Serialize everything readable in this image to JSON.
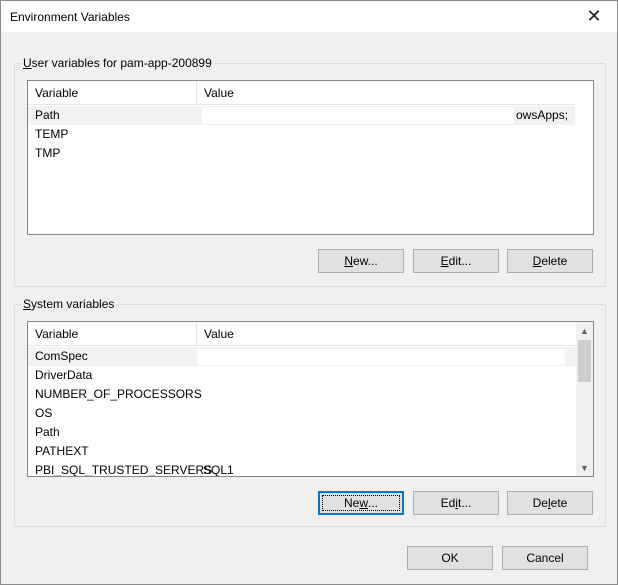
{
  "window": {
    "title": "Environment Variables",
    "close_glyph": "✕"
  },
  "user_group": {
    "label_prefix": "U",
    "label_rest": "ser variables for pam-app-200899",
    "columns": [
      "Variable",
      "Value"
    ],
    "rows": [
      {
        "variable": "Path",
        "value": "owsApps;"
      },
      {
        "variable": "TEMP",
        "value": ""
      },
      {
        "variable": "TMP",
        "value": ""
      }
    ],
    "buttons": {
      "new_u": "N",
      "new_rest": "ew...",
      "edit_u": "E",
      "edit_rest": "dit...",
      "delete_u": "D",
      "delete_rest": "elete"
    }
  },
  "system_group": {
    "label_prefix": "S",
    "label_rest": "ystem variables",
    "columns": [
      "Variable",
      "Value"
    ],
    "rows": [
      {
        "variable": "ComSpec",
        "value": ""
      },
      {
        "variable": "DriverData",
        "value": ""
      },
      {
        "variable": "NUMBER_OF_PROCESSORS",
        "value": ""
      },
      {
        "variable": "OS",
        "value": ""
      },
      {
        "variable": "Path",
        "value": ""
      },
      {
        "variable": "PATHEXT",
        "value": ""
      },
      {
        "variable": "PBI_SQL_TRUSTED_SERVERS",
        "value": "SQL1"
      }
    ],
    "buttons": {
      "new_u": "w",
      "new_pre": "Ne",
      "new_rest": "...",
      "edit_pre": "Ed",
      "edit_u": "i",
      "edit_rest": "t...",
      "delete_pre": "De",
      "delete_u": "l",
      "delete_rest": "ete"
    }
  },
  "footer": {
    "ok_label": "OK",
    "cancel_label": "Cancel"
  }
}
